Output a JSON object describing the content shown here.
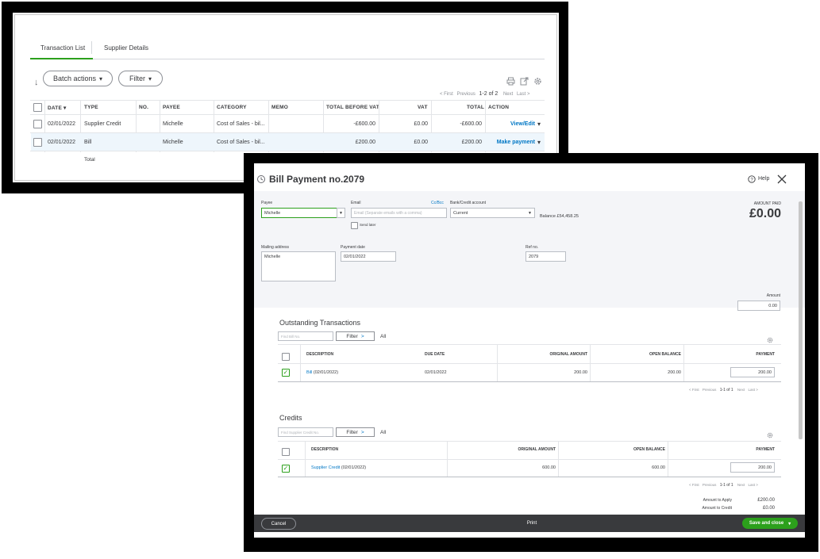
{
  "transaction_window": {
    "tabs": [
      {
        "label": "Transaction List",
        "active": true
      },
      {
        "label": "Supplier Details",
        "active": false
      }
    ],
    "toolbar": {
      "batch_actions": "Batch actions",
      "filter": "Filter",
      "chevron": "▾"
    },
    "pager": {
      "first": "< First",
      "previous": "Previous",
      "range": "1-2 of 2",
      "next": "Next",
      "last": "Last >"
    },
    "columns": [
      "DATE ▾",
      "TYPE",
      "NO.",
      "PAYEE",
      "CATEGORY",
      "MEMO",
      "TOTAL BEFORE VAT",
      "VAT",
      "TOTAL",
      "ACTION"
    ],
    "rows": [
      {
        "date": "02/01/2022",
        "type": "Supplier Credit",
        "no": "",
        "payee": "Michelle",
        "category": "Cost of Sales - bil...",
        "memo": "",
        "before_vat": "-£600.00",
        "vat": "£0.00",
        "total": "-£600.00",
        "action": "View/Edit"
      },
      {
        "date": "02/01/2022",
        "type": "Bill",
        "no": "",
        "payee": "Michelle",
        "category": "Cost of Sales - bil...",
        "memo": "",
        "before_vat": "£200.00",
        "vat": "£0.00",
        "total": "£200.00",
        "action": "Make payment"
      }
    ],
    "total_label": "Total",
    "accent_color": "#2ca01c",
    "link_color": "#0077c5"
  },
  "bill_payment": {
    "title": "Bill Payment no.2079",
    "help": "Help",
    "payee_label": "Payee",
    "payee_value": "Michelle",
    "email_label": "Email",
    "email_placeholder": "Email (Separate emails with a comma)",
    "cc_bcc": "Cc/Bcc",
    "send_later": "Send later",
    "bank_label": "Bank/Credit account",
    "bank_value": "Current",
    "balance": "Balance £54,458.25",
    "amount_paid_label": "AMOUNT PAID",
    "amount_paid_value": "£0.00",
    "mailing_label": "Mailing address",
    "mailing_value": "Michelle",
    "payment_date_label": "Payment date",
    "payment_date_value": "02/01/2022",
    "ref_label": "Ref no.",
    "ref_value": "2079",
    "amount_label": "Amount",
    "amount_value": "0.00",
    "outstanding": {
      "title": "Outstanding Transactions",
      "find_placeholder": "Find Bill No.",
      "filter": "Filter",
      "filter_chevron": ">",
      "all": "All",
      "columns": [
        "DESCRIPTION",
        "DUE DATE",
        "ORIGINAL AMOUNT",
        "OPEN BALANCE",
        "PAYMENT"
      ],
      "rows": [
        {
          "description_link": "Bill",
          "description_rest": " (02/01/2022)",
          "due_date": "02/01/2022",
          "original": "200.00",
          "open": "200.00",
          "payment": "200.00",
          "checked": true
        }
      ],
      "pager": {
        "first": "< First",
        "previous": "Previous",
        "range": "1-1 of 1",
        "next": "Next",
        "last": "Last >"
      }
    },
    "credits": {
      "title": "Credits",
      "find_placeholder": "Find Supplier Credit No.",
      "filter": "Filter",
      "filter_chevron": ">",
      "all": "All",
      "columns": [
        "DESCRIPTION",
        "ORIGINAL AMOUNT",
        "OPEN BALANCE",
        "PAYMENT"
      ],
      "rows": [
        {
          "description_link": "Supplier Credit",
          "description_rest": " (02/01/2022)",
          "original": "600.00",
          "open": "600.00",
          "payment": "200.00",
          "checked": true
        }
      ],
      "pager": {
        "first": "< First",
        "previous": "Previous",
        "range": "1-1 of 1",
        "next": "Next",
        "last": "Last >"
      }
    },
    "amount_to_apply_label": "Amount to Apply",
    "amount_to_apply_value": "£200.00",
    "amount_to_credit_label": "Amount to Credit",
    "amount_to_credit_value": "£0.00",
    "footer": {
      "cancel": "Cancel",
      "print": "Print",
      "save_close": "Save and close",
      "save_chevron": "▾"
    }
  }
}
